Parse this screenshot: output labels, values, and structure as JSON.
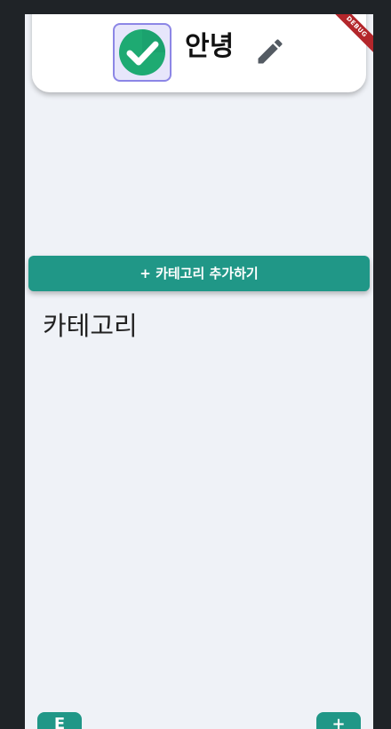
{
  "header": {
    "title": "안녕",
    "avatar_icon": "check-circle-icon",
    "edit_icon": "pencil-icon",
    "debug_banner": "DEBUG"
  },
  "main": {
    "add_category_label": "+ 카테고리 추가하기",
    "section_title": "카테고리"
  },
  "bottom": {
    "left_button_label": "E",
    "right_button_label": "+"
  },
  "colors": {
    "accent": "#209787",
    "background": "#eff2f7",
    "check_green": "#1eaa72"
  }
}
